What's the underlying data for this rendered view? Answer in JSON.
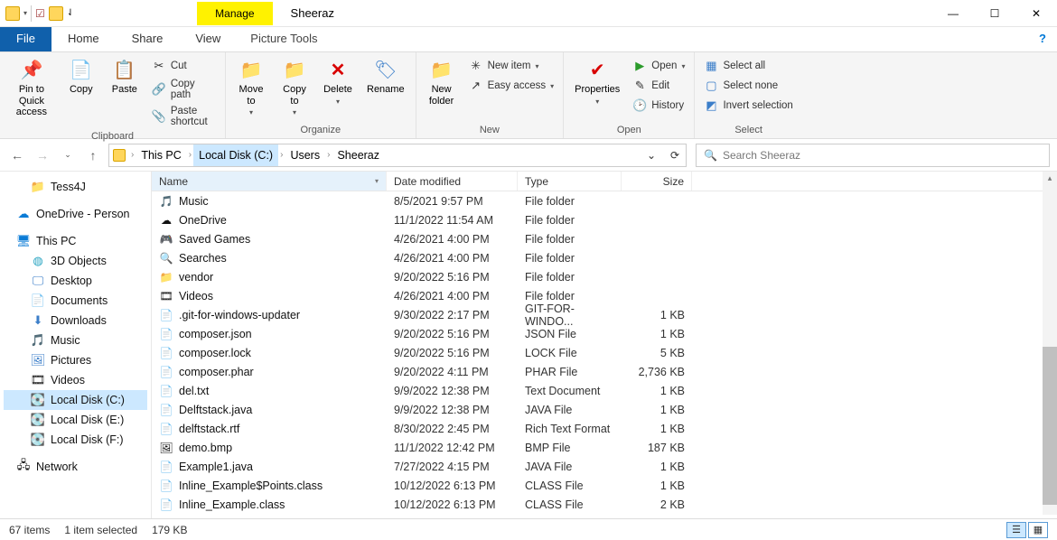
{
  "title": "Sheeraz",
  "manage_label": "Manage",
  "picture_tools_label": "Picture Tools",
  "tabs": {
    "file": "File",
    "home": "Home",
    "share": "Share",
    "view": "View"
  },
  "ribbon": {
    "clipboard": {
      "label": "Clipboard",
      "pin": "Pin to Quick\naccess",
      "copy": "Copy",
      "paste": "Paste",
      "cut": "Cut",
      "copy_path": "Copy path",
      "paste_shortcut": "Paste shortcut"
    },
    "organize": {
      "label": "Organize",
      "move_to": "Move\nto",
      "copy_to": "Copy\nto",
      "delete": "Delete",
      "rename": "Rename"
    },
    "new": {
      "label": "New",
      "new_folder": "New\nfolder",
      "new_item": "New item",
      "easy_access": "Easy access"
    },
    "open": {
      "label": "Open",
      "properties": "Properties",
      "open": "Open",
      "edit": "Edit",
      "history": "History"
    },
    "select": {
      "label": "Select",
      "select_all": "Select all",
      "select_none": "Select none",
      "invert": "Invert selection"
    }
  },
  "breadcrumbs": [
    "This PC",
    "Local Disk (C:)",
    "Users",
    "Sheeraz"
  ],
  "search_placeholder": "Search Sheeraz",
  "nav": {
    "tess4j": "Tess4J",
    "onedrive": "OneDrive - Person",
    "this_pc": "This PC",
    "objects3d": "3D Objects",
    "desktop": "Desktop",
    "documents": "Documents",
    "downloads": "Downloads",
    "music": "Music",
    "pictures": "Pictures",
    "videos": "Videos",
    "local_c": "Local Disk (C:)",
    "local_e": "Local Disk (E:)",
    "local_f": "Local Disk (F:)",
    "network": "Network"
  },
  "columns": {
    "name": "Name",
    "date": "Date modified",
    "type": "Type",
    "size": "Size"
  },
  "files": [
    {
      "icon": "🎵",
      "name": "Music",
      "date": "8/5/2021 9:57 PM",
      "type": "File folder",
      "size": ""
    },
    {
      "icon": "☁",
      "name": "OneDrive",
      "date": "11/1/2022 11:54 AM",
      "type": "File folder",
      "size": ""
    },
    {
      "icon": "🎮",
      "name": "Saved Games",
      "date": "4/26/2021 4:00 PM",
      "type": "File folder",
      "size": ""
    },
    {
      "icon": "🔍",
      "name": "Searches",
      "date": "4/26/2021 4:00 PM",
      "type": "File folder",
      "size": ""
    },
    {
      "icon": "📁",
      "name": "vendor",
      "date": "9/20/2022 5:16 PM",
      "type": "File folder",
      "size": ""
    },
    {
      "icon": "🎞",
      "name": "Videos",
      "date": "4/26/2021 4:00 PM",
      "type": "File folder",
      "size": ""
    },
    {
      "icon": "📄",
      "name": ".git-for-windows-updater",
      "date": "9/30/2022 2:17 PM",
      "type": "GIT-FOR-WINDO...",
      "size": "1 KB"
    },
    {
      "icon": "📄",
      "name": "composer.json",
      "date": "9/20/2022 5:16 PM",
      "type": "JSON File",
      "size": "1 KB"
    },
    {
      "icon": "📄",
      "name": "composer.lock",
      "date": "9/20/2022 5:16 PM",
      "type": "LOCK File",
      "size": "5 KB"
    },
    {
      "icon": "📄",
      "name": "composer.phar",
      "date": "9/20/2022 4:11 PM",
      "type": "PHAR File",
      "size": "2,736 KB"
    },
    {
      "icon": "📄",
      "name": "del.txt",
      "date": "9/9/2022 12:38 PM",
      "type": "Text Document",
      "size": "1 KB"
    },
    {
      "icon": "📄",
      "name": "Delftstack.java",
      "date": "9/9/2022 12:38 PM",
      "type": "JAVA File",
      "size": "1 KB"
    },
    {
      "icon": "📄",
      "name": "delftstack.rtf",
      "date": "8/30/2022 2:45 PM",
      "type": "Rich Text Format",
      "size": "1 KB"
    },
    {
      "icon": "🖼",
      "name": "demo.bmp",
      "date": "11/1/2022 12:42 PM",
      "type": "BMP File",
      "size": "187 KB"
    },
    {
      "icon": "📄",
      "name": "Example1.java",
      "date": "7/27/2022 4:15 PM",
      "type": "JAVA File",
      "size": "1 KB"
    },
    {
      "icon": "📄",
      "name": "Inline_Example$Points.class",
      "date": "10/12/2022 6:13 PM",
      "type": "CLASS File",
      "size": "1 KB"
    },
    {
      "icon": "📄",
      "name": "Inline_Example.class",
      "date": "10/12/2022 6:13 PM",
      "type": "CLASS File",
      "size": "2 KB"
    }
  ],
  "status": {
    "items": "67 items",
    "selected": "1 item selected",
    "size": "179 KB"
  }
}
